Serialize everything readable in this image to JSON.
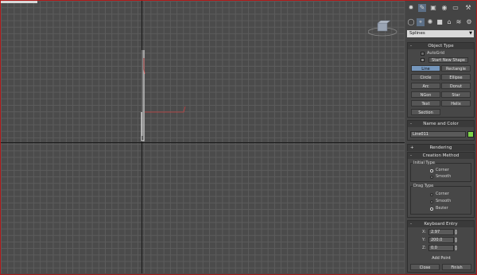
{
  "command_panel": {
    "category_dropdown": "Splines",
    "object_type": {
      "title": "Object Type",
      "autogrid": "AutoGrid",
      "start_new_shape": "Start New Shape",
      "buttons": [
        "Line",
        "Rectangle",
        "Circle",
        "Ellipse",
        "Arc",
        "Donut",
        "NGon",
        "Star",
        "Text",
        "Helix",
        "Section"
      ]
    },
    "name_and_color": {
      "title": "Name and Color",
      "name_value": "Line011",
      "color": "#7ed34a"
    },
    "rendering": {
      "title": "Rendering"
    },
    "creation_method": {
      "title": "Creation Method",
      "initial_type": {
        "label": "Initial Type",
        "options": [
          "Corner",
          "Smooth"
        ],
        "selected": "Corner"
      },
      "drag_type": {
        "label": "Drag Type",
        "options": [
          "Corner",
          "Smooth",
          "Bezier"
        ],
        "selected": "Bezier"
      }
    },
    "keyboard_entry": {
      "title": "Keyboard Entry",
      "x_label": "X:",
      "x_value": "2.97",
      "y_label": "Y:",
      "y_value": "200.0",
      "z_label": "Z:",
      "z_value": "0.0",
      "add_point": "Add Point",
      "close": "Close",
      "finish": "Finish"
    },
    "rollout_expand": "+",
    "rollout_collapse": "-"
  }
}
